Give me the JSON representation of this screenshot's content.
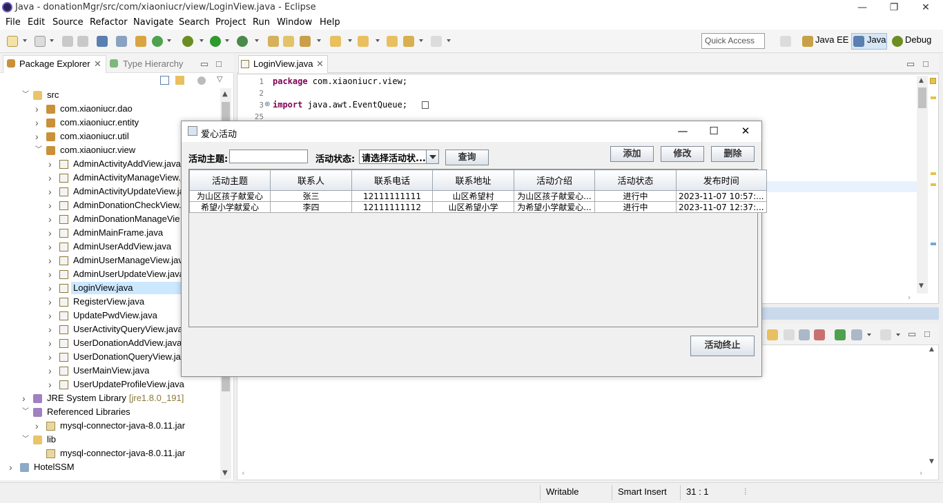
{
  "window": {
    "title": "Java - donationMgr/src/com/xiaoniucr/view/LoginView.java - Eclipse",
    "controls": {
      "minimize": "—",
      "maximize": "❐",
      "close": "✕"
    }
  },
  "menu": [
    "File",
    "Edit",
    "Source",
    "Refactor",
    "Navigate",
    "Search",
    "Project",
    "Run",
    "Window",
    "Help"
  ],
  "toolbar": {
    "quick_access": "Quick Access",
    "perspectives": [
      "Java EE",
      "Java",
      "Debug"
    ]
  },
  "left_panel": {
    "tabs": [
      "Package Explorer",
      "Type Hierarchy"
    ],
    "tree": [
      {
        "label": "src",
        "level": 0,
        "icon": "folder",
        "expanded": true
      },
      {
        "label": "com.xiaoniucr.dao",
        "level": 1,
        "icon": "package",
        "expanded": false
      },
      {
        "label": "com.xiaoniucr.entity",
        "level": 1,
        "icon": "package",
        "expanded": false
      },
      {
        "label": "com.xiaoniucr.util",
        "level": 1,
        "icon": "package",
        "expanded": false
      },
      {
        "label": "com.xiaoniucr.view",
        "level": 1,
        "icon": "package",
        "expanded": true
      },
      {
        "label": "AdminActivityAddView.java",
        "level": 2,
        "icon": "java"
      },
      {
        "label": "AdminActivityManageView.j",
        "level": 2,
        "icon": "java"
      },
      {
        "label": "AdminActivityUpdateView.ja",
        "level": 2,
        "icon": "java"
      },
      {
        "label": "AdminDonationCheckView.j",
        "level": 2,
        "icon": "java"
      },
      {
        "label": "AdminDonationManageVie",
        "level": 2,
        "icon": "java"
      },
      {
        "label": "AdminMainFrame.java",
        "level": 2,
        "icon": "java"
      },
      {
        "label": "AdminUserAddView.java",
        "level": 2,
        "icon": "java"
      },
      {
        "label": "AdminUserManageView.jav",
        "level": 2,
        "icon": "java"
      },
      {
        "label": "AdminUserUpdateView.java",
        "level": 2,
        "icon": "java"
      },
      {
        "label": "LoginView.java",
        "level": 2,
        "icon": "java",
        "selected": true
      },
      {
        "label": "RegisterView.java",
        "level": 2,
        "icon": "java"
      },
      {
        "label": "UpdatePwdView.java",
        "level": 2,
        "icon": "java"
      },
      {
        "label": "UserActivityQueryView.java",
        "level": 2,
        "icon": "java"
      },
      {
        "label": "UserDonationAddView.java",
        "level": 2,
        "icon": "java"
      },
      {
        "label": "UserDonationQueryView.jav",
        "level": 2,
        "icon": "java"
      },
      {
        "label": "UserMainView.java",
        "level": 2,
        "icon": "java"
      },
      {
        "label": "UserUpdateProfileView.java",
        "level": 2,
        "icon": "java"
      },
      {
        "label": "JRE System Library",
        "suffix": "[jre1.8.0_191]",
        "level": 0,
        "icon": "library",
        "expanded": false
      },
      {
        "label": "Referenced Libraries",
        "level": 0,
        "icon": "library",
        "expanded": true
      },
      {
        "label": "mysql-connector-java-8.0.11.jar",
        "level": 1,
        "icon": "jar",
        "expanded": false
      },
      {
        "label": "lib",
        "level": 0,
        "icon": "folder",
        "expanded": true
      },
      {
        "label": "mysql-connector-java-8.0.11.jar",
        "level": 1,
        "icon": "jar",
        "leaf": true
      },
      {
        "label": "HotelSSM",
        "level": -1,
        "icon": "project",
        "expanded": false
      }
    ]
  },
  "editor": {
    "tab": "LoginView.java",
    "lines": [
      {
        "num": "1",
        "kw": "package",
        "text": " com.xiaoniucr.view;"
      },
      {
        "num": "2",
        "kw": "",
        "text": ""
      },
      {
        "num": "3",
        "kw": "import",
        "text": " java.awt.EventQueue;"
      },
      {
        "num": "25",
        "kw": "",
        "text": ""
      }
    ]
  },
  "status_bar": {
    "writable": "Writable",
    "insert_mode": "Smart Insert",
    "position": "31 : 1"
  },
  "dialog": {
    "title": "爱心活动",
    "subject_label": "活动主题:",
    "subject_value": "",
    "status_label": "活动状态:",
    "status_selected": "请选择活动状...",
    "query_button": "查询",
    "add_button": "添加",
    "edit_button": "修改",
    "delete_button": "删除",
    "terminate_button": "活动终止",
    "table": {
      "columns": [
        "活动主题",
        "联系人",
        "联系电话",
        "联系地址",
        "活动介绍",
        "活动状态",
        "发布时间"
      ],
      "rows": [
        [
          "为山区孩子献爱心",
          "张三",
          "12111111111",
          "山区希望村",
          "为山区孩子献爱心...",
          "进行中",
          "2023-11-07 10:57:..."
        ],
        [
          "希望小学献爱心",
          "李四",
          "12111111112",
          "山区希望小学",
          "为希望小学献爱心...",
          "进行中",
          "2023-11-07 12:37:..."
        ]
      ]
    }
  }
}
